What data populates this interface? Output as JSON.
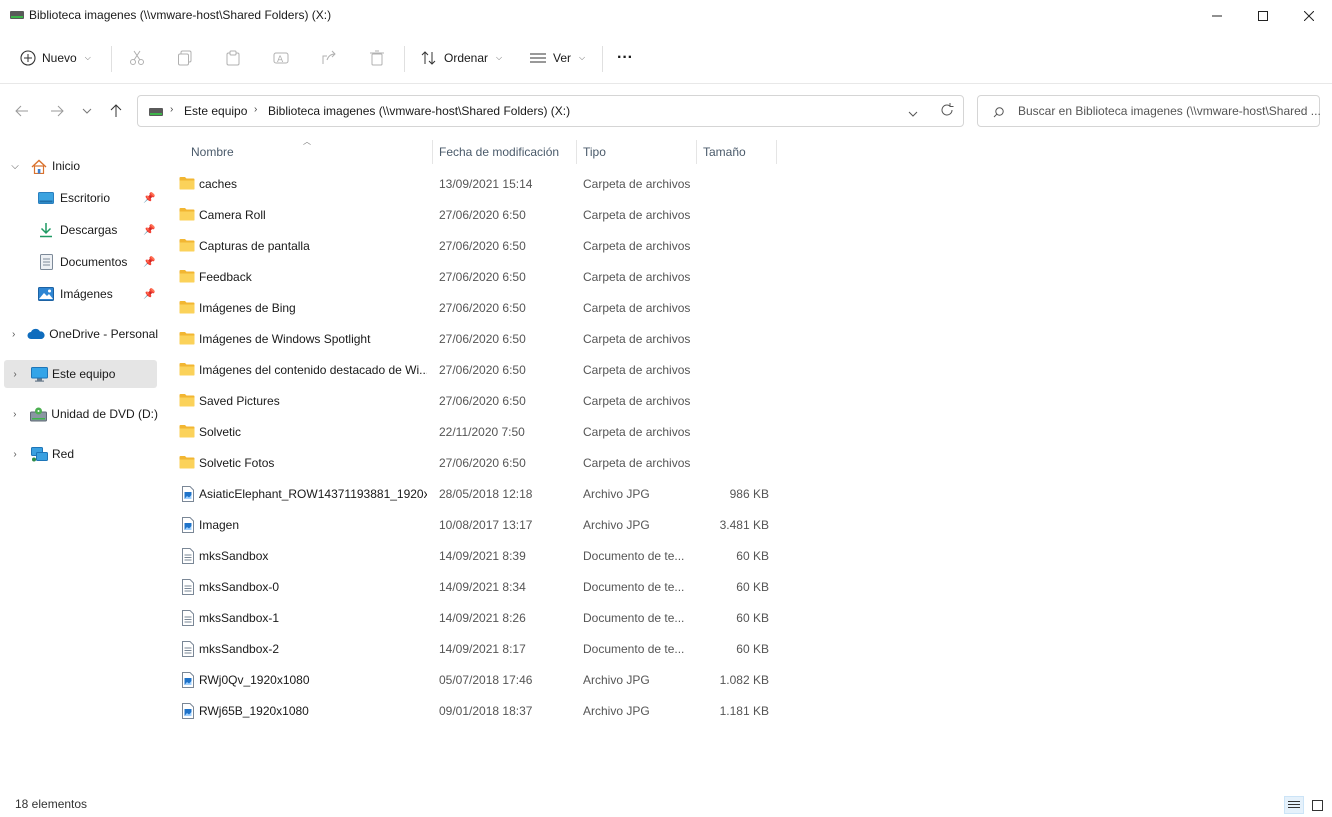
{
  "window": {
    "title": "Biblioteca imagenes (\\\\vmware-host\\Shared Folders) (X:)"
  },
  "toolbar": {
    "new_label": "Nuevo",
    "sort_label": "Ordenar",
    "view_label": "Ver",
    "more_label": "···"
  },
  "address": {
    "crumbs": [
      "Este equipo",
      "Biblioteca imagenes (\\\\vmware-host\\Shared Folders) (X:)"
    ]
  },
  "search": {
    "placeholder": "Buscar en Biblioteca imagenes (\\\\vmware-host\\Shared ..."
  },
  "nav": {
    "items": [
      {
        "label": "Inicio",
        "icon": "home-icon"
      },
      {
        "label": "Escritorio",
        "icon": "desktop-icon",
        "pinned": true
      },
      {
        "label": "Descargas",
        "icon": "download-icon",
        "pinned": true
      },
      {
        "label": "Documentos",
        "icon": "documents-icon",
        "pinned": true
      },
      {
        "label": "Imágenes",
        "icon": "pictures-icon",
        "pinned": true
      },
      {
        "label": "OneDrive - Personal",
        "icon": "onedrive-icon"
      },
      {
        "label": "Este equipo",
        "icon": "this-pc-icon",
        "selected": true
      },
      {
        "label": "Unidad de DVD (D:)",
        "icon": "dvd-icon"
      },
      {
        "label": "Red",
        "icon": "network-icon"
      }
    ]
  },
  "columns": {
    "name": "Nombre",
    "date": "Fecha de modificación",
    "type": "Tipo",
    "size": "Tamaño"
  },
  "files": [
    {
      "name": "caches",
      "date": "13/09/2021 15:14",
      "type": "Carpeta de archivos",
      "size": "",
      "kind": "folder"
    },
    {
      "name": "Camera Roll",
      "date": "27/06/2020 6:50",
      "type": "Carpeta de archivos",
      "size": "",
      "kind": "folder"
    },
    {
      "name": "Capturas de pantalla",
      "date": "27/06/2020 6:50",
      "type": "Carpeta de archivos",
      "size": "",
      "kind": "folder"
    },
    {
      "name": "Feedback",
      "date": "27/06/2020 6:50",
      "type": "Carpeta de archivos",
      "size": "",
      "kind": "folder"
    },
    {
      "name": "Imágenes de Bing",
      "date": "27/06/2020 6:50",
      "type": "Carpeta de archivos",
      "size": "",
      "kind": "folder"
    },
    {
      "name": "Imágenes de Windows Spotlight",
      "date": "27/06/2020 6:50",
      "type": "Carpeta de archivos",
      "size": "",
      "kind": "folder"
    },
    {
      "name": "Imágenes del contenido destacado de Wi...",
      "date": "27/06/2020 6:50",
      "type": "Carpeta de archivos",
      "size": "",
      "kind": "folder"
    },
    {
      "name": "Saved Pictures",
      "date": "27/06/2020 6:50",
      "type": "Carpeta de archivos",
      "size": "",
      "kind": "folder"
    },
    {
      "name": "Solvetic",
      "date": "22/11/2020 7:50",
      "type": "Carpeta de archivos",
      "size": "",
      "kind": "folder"
    },
    {
      "name": "Solvetic Fotos",
      "date": "27/06/2020 6:50",
      "type": "Carpeta de archivos",
      "size": "",
      "kind": "folder"
    },
    {
      "name": "AsiaticElephant_ROW14371193881_1920x...",
      "date": "28/05/2018 12:18",
      "type": "Archivo JPG",
      "size": "986 KB",
      "kind": "image"
    },
    {
      "name": "Imagen",
      "date": "10/08/2017 13:17",
      "type": "Archivo JPG",
      "size": "3.481 KB",
      "kind": "image"
    },
    {
      "name": "mksSandbox",
      "date": "14/09/2021 8:39",
      "type": "Documento de te...",
      "size": "60 KB",
      "kind": "text"
    },
    {
      "name": "mksSandbox-0",
      "date": "14/09/2021 8:34",
      "type": "Documento de te...",
      "size": "60 KB",
      "kind": "text"
    },
    {
      "name": "mksSandbox-1",
      "date": "14/09/2021 8:26",
      "type": "Documento de te...",
      "size": "60 KB",
      "kind": "text"
    },
    {
      "name": "mksSandbox-2",
      "date": "14/09/2021 8:17",
      "type": "Documento de te...",
      "size": "60 KB",
      "kind": "text"
    },
    {
      "name": "RWj0Qv_1920x1080",
      "date": "05/07/2018 17:46",
      "type": "Archivo JPG",
      "size": "1.082 KB",
      "kind": "image"
    },
    {
      "name": "RWj65B_1920x1080",
      "date": "09/01/2018 18:37",
      "type": "Archivo JPG",
      "size": "1.181 KB",
      "kind": "image"
    }
  ],
  "status": {
    "count": "18 elementos"
  },
  "colors": {
    "folder": "#f8c944",
    "selected_bg": "#e5e5e5",
    "accent": "#0067c0"
  }
}
